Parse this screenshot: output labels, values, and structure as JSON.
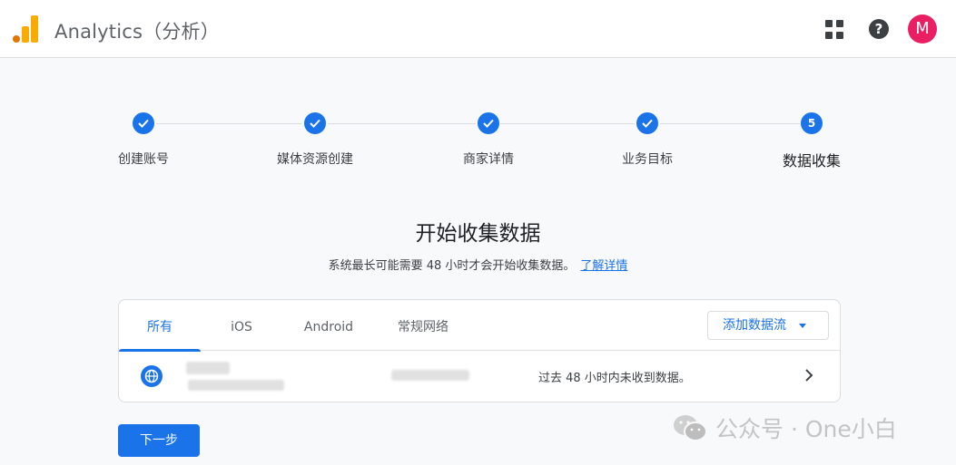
{
  "header": {
    "app_title": "Analytics（分析）",
    "logo_icon": "analytics-logo",
    "apps_icon": "apps-grid-icon",
    "help_icon": "help-icon",
    "help_glyph": "?",
    "avatar_letter": "M",
    "colors": {
      "logo_orange": "#f9ab00",
      "logo_dark": "#e37400",
      "avatar": "#e91e63"
    }
  },
  "stepper": {
    "steps": [
      {
        "label": "创建账号",
        "state": "done"
      },
      {
        "label": "媒体资源创建",
        "state": "done"
      },
      {
        "label": "商家详情",
        "state": "done"
      },
      {
        "label": "业务目标",
        "state": "done"
      },
      {
        "label": "数据收集",
        "state": "current",
        "number": "5"
      }
    ]
  },
  "main": {
    "heading": "开始收集数据",
    "subtext": "系统最长可能需要 48 小时才会开始收集数据。",
    "learn_more": "了解详情"
  },
  "streams": {
    "tabs": [
      {
        "label": "所有",
        "active": true
      },
      {
        "label": "iOS",
        "active": false
      },
      {
        "label": "Android",
        "active": false
      },
      {
        "label": "常规网络",
        "active": false
      }
    ],
    "add_button": "添加数据流",
    "rows": [
      {
        "icon": "globe-icon",
        "status": "过去 48 小时内未收到数据。"
      }
    ]
  },
  "actions": {
    "next_button": "下一步"
  },
  "watermark": {
    "text": "公众号 · One小白"
  },
  "colors": {
    "accent": "#1a73e8",
    "background": "#f8f9fa"
  }
}
